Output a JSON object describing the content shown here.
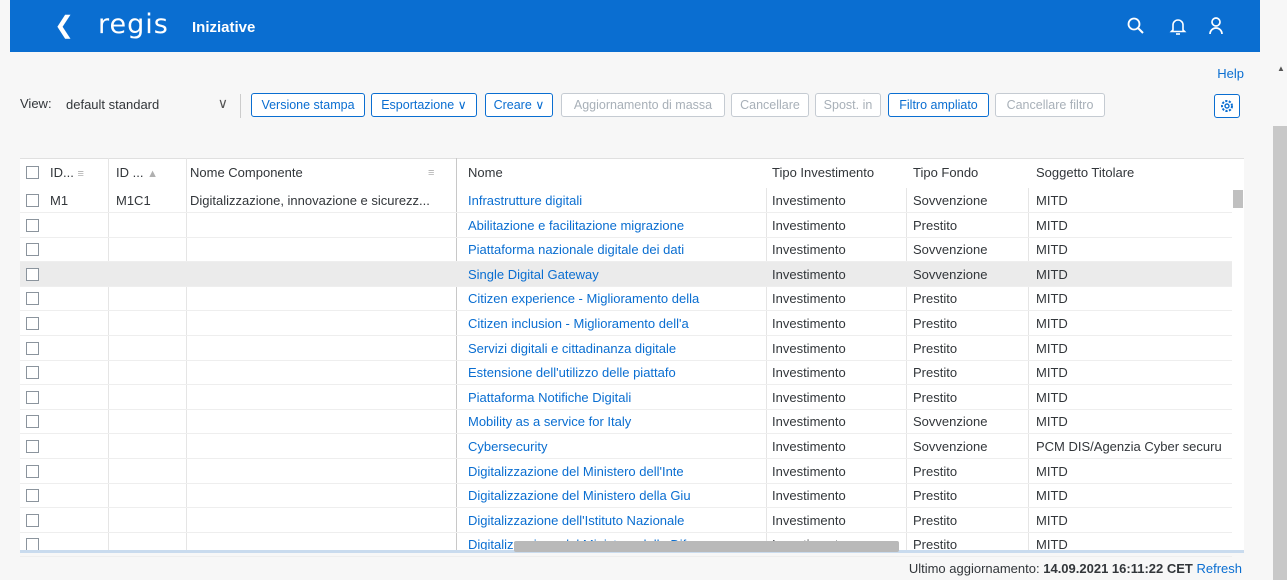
{
  "shell": {
    "logo": "regis",
    "title": "Iniziative"
  },
  "help_label": "Help",
  "toolbar": {
    "view_label": "View:",
    "view_value": "default standard",
    "versione_stampa": "Versione stampa",
    "esportazione": "Esportazione ∨",
    "creare": "Creare ∨",
    "aggiornamento": "Aggiornamento di massa",
    "cancellare": "Cancellare",
    "spost": "Spost. in",
    "filtro_ampliato": "Filtro ampliato",
    "cancellare_filtro": "Cancellare filtro"
  },
  "columns": {
    "id1": "ID...",
    "id2": "ID ...",
    "nome_componente": "Nome Componente",
    "nome": "Nome",
    "tipo_investimento": "Tipo Investimento",
    "tipo_fondo": "Tipo Fondo",
    "soggetto_titolare": "Soggetto Titolare"
  },
  "left_first_row": {
    "id1": "M1",
    "id2": "M1C1",
    "nome_componente": "Digitalizzazione, innovazione e sicurezz..."
  },
  "rows": [
    {
      "nome": "Infrastrutture digitali",
      "tipo": "Investimento",
      "fondo": "Sovvenzione",
      "soggetto": "MITD"
    },
    {
      "nome": "Abilitazione e facilitazione migrazione",
      "tipo": "Investimento",
      "fondo": "Prestito",
      "soggetto": "MITD"
    },
    {
      "nome": "Piattaforma nazionale digitale dei dati",
      "tipo": "Investimento",
      "fondo": "Sovvenzione",
      "soggetto": "MITD"
    },
    {
      "nome": "Single Digital Gateway",
      "tipo": "Investimento",
      "fondo": "Sovvenzione",
      "soggetto": "MITD"
    },
    {
      "nome": "Citizen experience - Miglioramento della",
      "tipo": "Investimento",
      "fondo": "Prestito",
      "soggetto": "MITD"
    },
    {
      "nome": "Citizen inclusion - Miglioramento dell'a",
      "tipo": "Investimento",
      "fondo": "Prestito",
      "soggetto": "MITD"
    },
    {
      "nome": "Servizi digitali e cittadinanza digitale",
      "tipo": "Investimento",
      "fondo": "Prestito",
      "soggetto": "MITD"
    },
    {
      "nome": "Estensione dell'utilizzo delle piattafo",
      "tipo": "Investimento",
      "fondo": "Prestito",
      "soggetto": "MITD"
    },
    {
      "nome": "Piattaforma Notifiche Digitali",
      "tipo": "Investimento",
      "fondo": "Prestito",
      "soggetto": "MITD"
    },
    {
      "nome": "Mobility as a service for Italy",
      "tipo": "Investimento",
      "fondo": "Sovvenzione",
      "soggetto": "MITD"
    },
    {
      "nome": "Cybersecurity",
      "tipo": "Investimento",
      "fondo": "Sovvenzione",
      "soggetto": "PCM DIS/Agenzia Cyber securu"
    },
    {
      "nome": "Digitalizzazione del Ministero dell'Inte",
      "tipo": "Investimento",
      "fondo": "Prestito",
      "soggetto": "MITD"
    },
    {
      "nome": "Digitalizzazione del Ministero della Giu",
      "tipo": "Investimento",
      "fondo": "Prestito",
      "soggetto": "MITD"
    },
    {
      "nome": "Digitalizzazione dell'Istituto Nazionale",
      "tipo": "Investimento",
      "fondo": "Prestito",
      "soggetto": "MITD"
    },
    {
      "nome": "Digitalizzazione del Ministero della Dif",
      "tipo": "Investimento",
      "fondo": "Prestito",
      "soggetto": "MITD"
    }
  ],
  "footer": {
    "label": "Ultimo aggiornamento:",
    "timestamp": "14.09.2021 16:11:22 CET",
    "refresh": "Refresh"
  },
  "colors": {
    "brand": "#0a6ed1",
    "link": "#0a6ed1"
  },
  "icons": [
    "back-icon",
    "search-icon",
    "bell-icon",
    "user-icon",
    "gear-icon",
    "chevron-down-icon",
    "sort-icon"
  ]
}
